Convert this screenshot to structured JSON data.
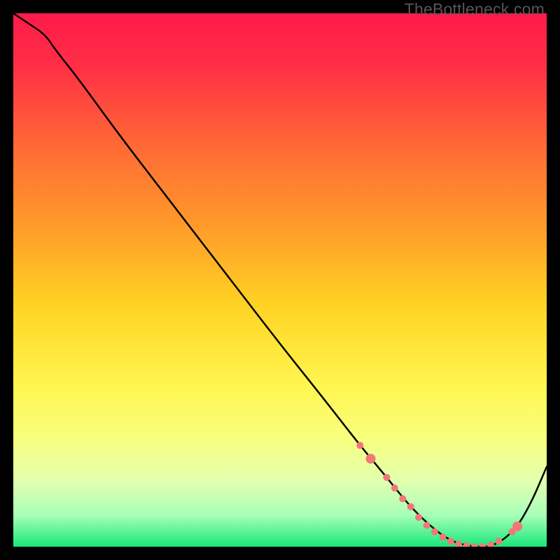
{
  "watermark": "TheBottleneck.com",
  "chart_data": {
    "type": "line",
    "title": "",
    "xlabel": "",
    "ylabel": "",
    "xlim": [
      0,
      100
    ],
    "ylim": [
      0,
      100
    ],
    "background_gradient": {
      "stops": [
        {
          "offset": 0.0,
          "color": "#ff1a4a"
        },
        {
          "offset": 0.1,
          "color": "#ff2f45"
        },
        {
          "offset": 0.25,
          "color": "#ff6a35"
        },
        {
          "offset": 0.4,
          "color": "#ff9b2a"
        },
        {
          "offset": 0.55,
          "color": "#ffd423"
        },
        {
          "offset": 0.7,
          "color": "#fff650"
        },
        {
          "offset": 0.8,
          "color": "#f8ff80"
        },
        {
          "offset": 0.88,
          "color": "#e0ffb0"
        },
        {
          "offset": 0.94,
          "color": "#a8ffb8"
        },
        {
          "offset": 1.0,
          "color": "#18e87a"
        }
      ]
    },
    "curve": {
      "comment": "Main black curve. y=100 at left edge, descends to ~0 near x≈80, flat valley, rises back at right.",
      "x": [
        0,
        3,
        6,
        8,
        12,
        20,
        30,
        40,
        50,
        58,
        65,
        70,
        74,
        78,
        82,
        86,
        90,
        94,
        97,
        100
      ],
      "y": [
        100,
        98,
        96,
        93,
        88,
        77,
        64,
        51,
        38,
        28,
        19,
        13,
        8,
        4,
        1,
        0,
        0,
        3,
        8,
        15
      ]
    },
    "markers": {
      "comment": "Pink dotted markers along the valley portion of the curve.",
      "color": "#f07878",
      "points": [
        {
          "x": 65.0,
          "y": 19.0,
          "r": 5
        },
        {
          "x": 67.0,
          "y": 16.5,
          "r": 7
        },
        {
          "x": 70.0,
          "y": 13.0,
          "r": 5
        },
        {
          "x": 71.5,
          "y": 11.0,
          "r": 5
        },
        {
          "x": 73.0,
          "y": 9.0,
          "r": 5
        },
        {
          "x": 74.5,
          "y": 7.5,
          "r": 5
        },
        {
          "x": 76.0,
          "y": 5.5,
          "r": 5
        },
        {
          "x": 77.5,
          "y": 4.0,
          "r": 5
        },
        {
          "x": 79.0,
          "y": 2.8,
          "r": 5
        },
        {
          "x": 80.5,
          "y": 1.8,
          "r": 5
        },
        {
          "x": 82.0,
          "y": 1.0,
          "r": 5
        },
        {
          "x": 83.5,
          "y": 0.5,
          "r": 5
        },
        {
          "x": 85.0,
          "y": 0.2,
          "r": 5
        },
        {
          "x": 86.5,
          "y": 0.0,
          "r": 5
        },
        {
          "x": 88.0,
          "y": 0.0,
          "r": 5
        },
        {
          "x": 89.5,
          "y": 0.3,
          "r": 5
        },
        {
          "x": 91.0,
          "y": 1.0,
          "r": 5
        },
        {
          "x": 93.5,
          "y": 2.8,
          "r": 5
        },
        {
          "x": 94.5,
          "y": 3.8,
          "r": 7
        }
      ]
    }
  }
}
